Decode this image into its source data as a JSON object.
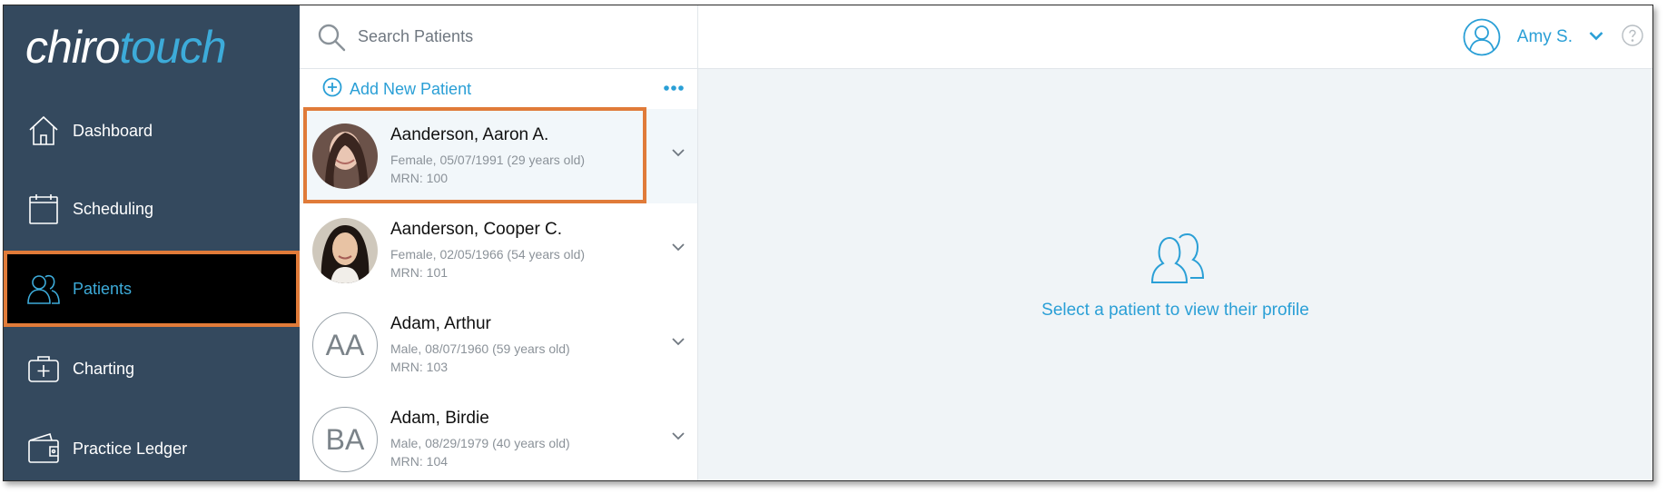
{
  "app": {
    "logo_part1": "chiro",
    "logo_part2": "touch"
  },
  "sidebar": {
    "items": [
      {
        "label": "Dashboard",
        "icon": "home-icon"
      },
      {
        "label": "Scheduling",
        "icon": "calendar-icon"
      },
      {
        "label": "Patients",
        "icon": "users-icon",
        "active": true
      },
      {
        "label": "Charting",
        "icon": "medical-kit-icon"
      },
      {
        "label": "Practice Ledger",
        "icon": "wallet-icon"
      }
    ]
  },
  "search": {
    "placeholder": "Search Patients"
  },
  "list": {
    "add_label": "Add New Patient",
    "patients": [
      {
        "name": "Aanderson, Aaron A.",
        "details": "Female, 05/07/1991 (29 years old)",
        "mrn": "MRN: 100",
        "avatar": "photo"
      },
      {
        "name": "Aanderson, Cooper C.",
        "details": "Female, 02/05/1966 (54 years old)",
        "mrn": "MRN: 101",
        "avatar": "photo"
      },
      {
        "name": "Adam, Arthur",
        "details": "Male, 08/07/1960 (59 years old)",
        "mrn": "MRN: 103",
        "initials": "AA"
      },
      {
        "name": "Adam, Birdie",
        "details": "Male, 08/29/1979 (40 years old)",
        "mrn": "MRN: 104",
        "initials": "BA"
      }
    ]
  },
  "user": {
    "name": "Amy S."
  },
  "main": {
    "empty_text": "Select a patient to view their profile"
  },
  "colors": {
    "sidebar": "#34495e",
    "accent": "#2a9fd6",
    "highlight": "#e07b39"
  }
}
